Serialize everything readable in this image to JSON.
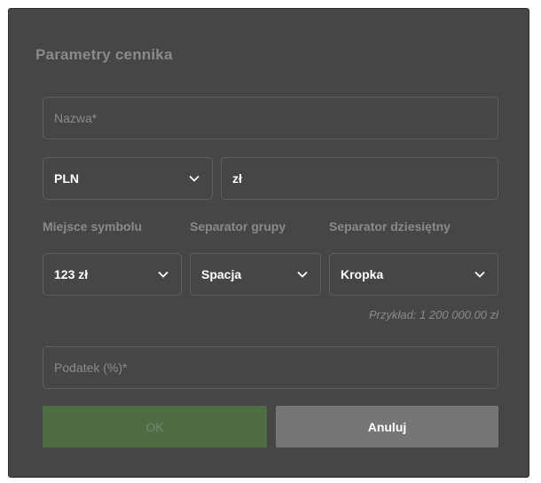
{
  "dialog": {
    "title": "Parametry cennika",
    "name_placeholder": "Nazwa*",
    "currency": {
      "selected": "PLN",
      "symbol_value": "zł"
    },
    "labels": {
      "symbol_position": "Miejsce symbolu",
      "group_separator": "Separator grupy",
      "decimal_separator": "Separator dziesiętny"
    },
    "symbol_position_value": "123 zł",
    "group_separator_value": "Spacja",
    "decimal_separator_value": "Kropka",
    "example": "Przykład: 1 200 000.00 zł",
    "tax_placeholder": "Podatek (%)*",
    "ok_label": "OK",
    "cancel_label": "Anuluj"
  },
  "icons": {
    "dropdown": "chevron-down-icon"
  },
  "colors": {
    "dialog_bg": "#464646",
    "ok_bg": "#4e6d45",
    "cancel_bg": "#767676"
  }
}
